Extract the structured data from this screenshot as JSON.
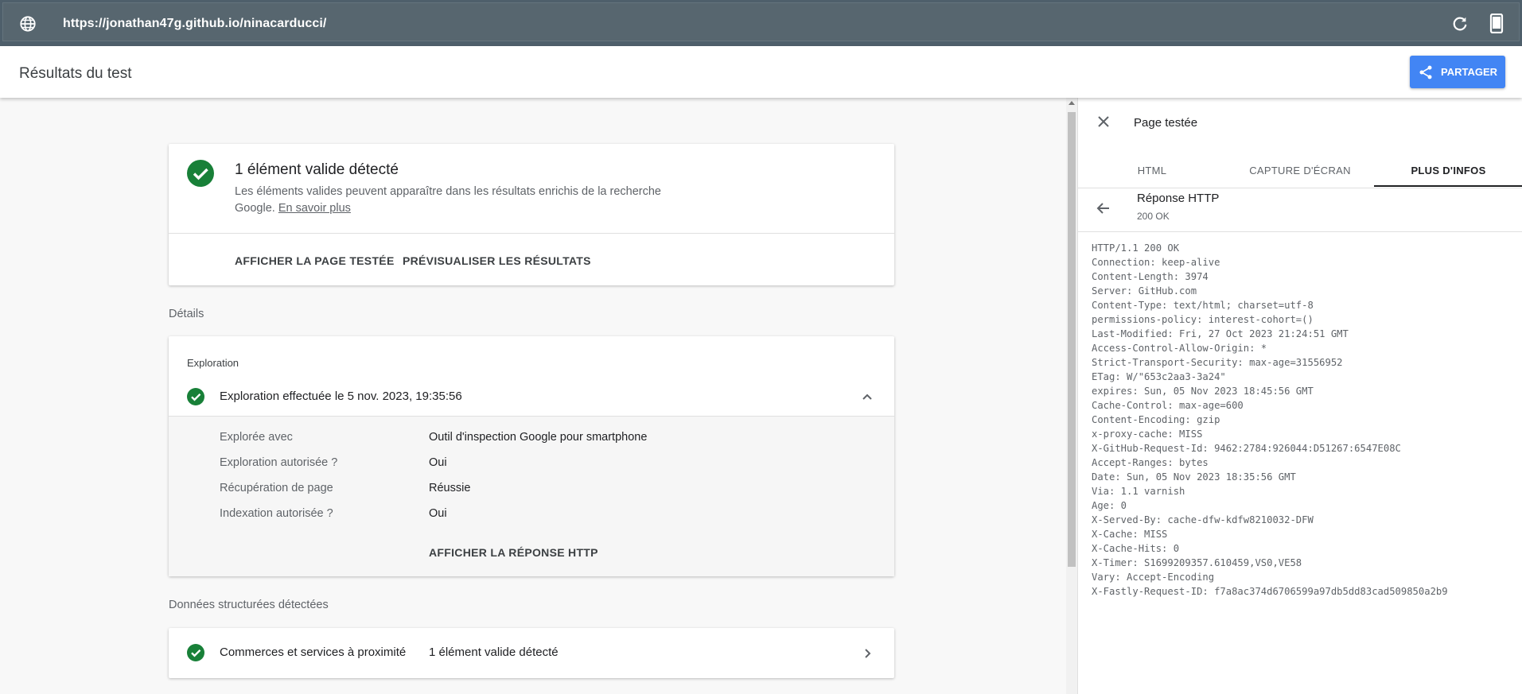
{
  "browser": {
    "url": "https://jonathan47g.github.io/ninacarducci/"
  },
  "header": {
    "title": "Résultats du test",
    "share_label": "PARTAGER",
    "accent": "#4285f4"
  },
  "summary": {
    "title": "1 élément valide détecté",
    "description": "Les éléments valides peuvent apparaître dans les résultats enrichis de la recherche Google.",
    "link": "En savoir plus",
    "actions": [
      "AFFICHER LA PAGE TESTÉE",
      "PRÉVISUALISER LES RÉSULTATS"
    ],
    "status_color": "#188038"
  },
  "details": {
    "section_label": "Détails",
    "group_label": "Exploration",
    "crawl_title": "Exploration effectuée le 5 nov. 2023, 19:35:56",
    "rows": [
      {
        "key": "Explorée avec",
        "value": "Outil d'inspection Google pour smartphone"
      },
      {
        "key": "Exploration autorisée ?",
        "value": "Oui"
      },
      {
        "key": "Récupération de page",
        "value": "Réussie"
      },
      {
        "key": "Indexation autorisée ?",
        "value": "Oui"
      }
    ],
    "http_link": "AFFICHER LA RÉPONSE HTTP"
  },
  "structured": {
    "section_label": "Données structurées détectées",
    "item_title": "Commerces et services à proximité",
    "item_value": "1 élément valide détecté"
  },
  "panel": {
    "title": "Page testée",
    "tabs": [
      "HTML",
      "CAPTURE D'ÉCRAN",
      "PLUS D'INFOS"
    ],
    "active_tab": "PLUS D'INFOS",
    "http_title": "Réponse HTTP",
    "http_status": "200 OK",
    "headers": [
      "HTTP/1.1 200 OK",
      "Connection: keep-alive",
      "Content-Length: 3974",
      "Server: GitHub.com",
      "Content-Type: text/html; charset=utf-8",
      "permissions-policy: interest-cohort=()",
      "Last-Modified: Fri, 27 Oct 2023 21:24:51 GMT",
      "Access-Control-Allow-Origin: *",
      "Strict-Transport-Security: max-age=31556952",
      "ETag: W/\"653c2aa3-3a24\"",
      "expires: Sun, 05 Nov 2023 18:45:56 GMT",
      "Cache-Control: max-age=600",
      "Content-Encoding: gzip",
      "x-proxy-cache: MISS",
      "X-GitHub-Request-Id: 9462:2784:926044:D51267:6547E08C",
      "Accept-Ranges: bytes",
      "Date: Sun, 05 Nov 2023 18:35:56 GMT",
      "Via: 1.1 varnish",
      "Age: 0",
      "X-Served-By: cache-dfw-kdfw8210032-DFW",
      "X-Cache: MISS",
      "X-Cache-Hits: 0",
      "X-Timer: S1699209357.610459,VS0,VE58",
      "Vary: Accept-Encoding",
      "X-Fastly-Request-ID: f7a8ac374d6706599a97db5dd83cad509850a2b9"
    ]
  }
}
